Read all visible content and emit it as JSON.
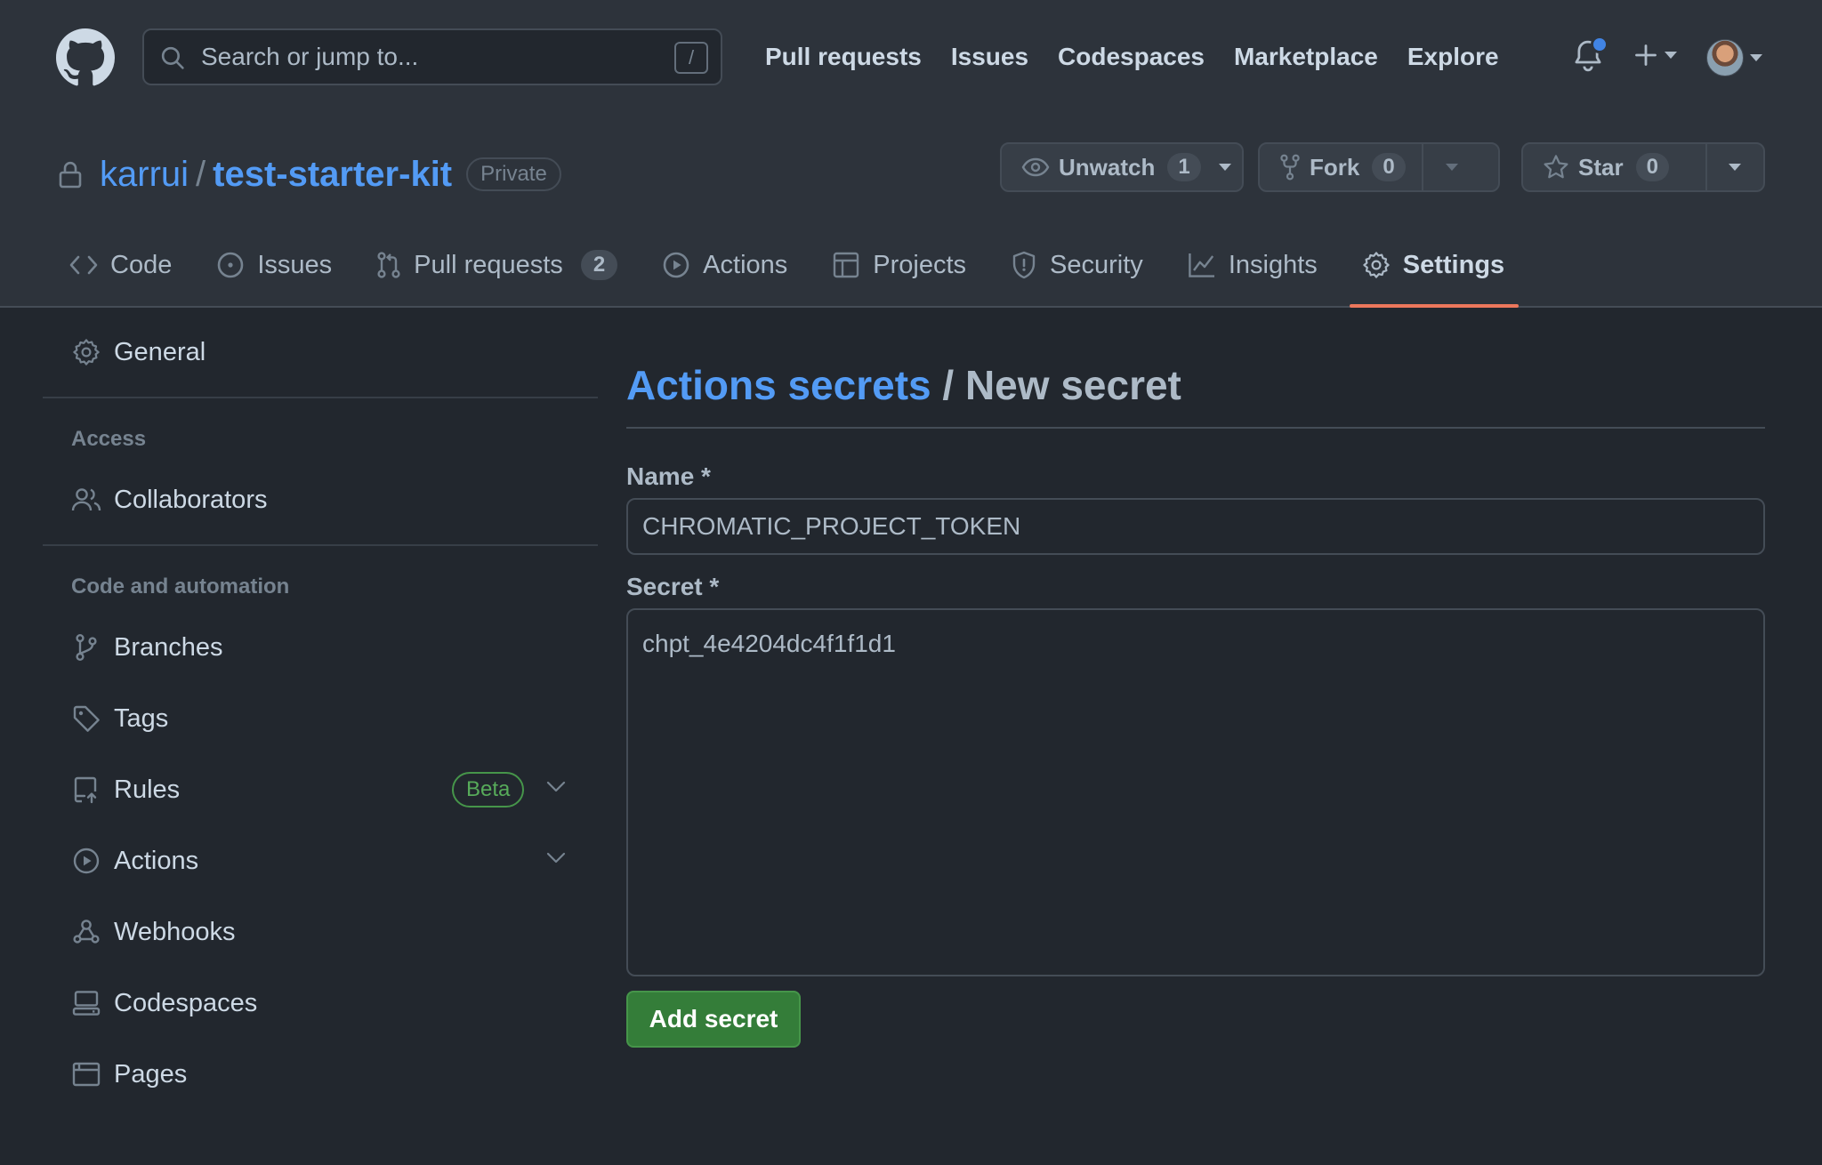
{
  "header": {
    "search_placeholder": "Search or jump to...",
    "search_shortcut": "/",
    "nav": [
      "Pull requests",
      "Issues",
      "Codespaces",
      "Marketplace",
      "Explore"
    ]
  },
  "repo": {
    "owner": "karrui",
    "separator": "/",
    "name": "test-starter-kit",
    "visibility": "Private",
    "unwatch_label": "Unwatch",
    "unwatch_count": "1",
    "fork_label": "Fork",
    "fork_count": "0",
    "star_label": "Star",
    "star_count": "0"
  },
  "tabs": [
    {
      "label": "Code",
      "icon": "code-icon"
    },
    {
      "label": "Issues",
      "icon": "issue-icon"
    },
    {
      "label": "Pull requests",
      "icon": "pull-request-icon",
      "counter": "2"
    },
    {
      "label": "Actions",
      "icon": "play-icon"
    },
    {
      "label": "Projects",
      "icon": "table-icon"
    },
    {
      "label": "Security",
      "icon": "shield-icon"
    },
    {
      "label": "Insights",
      "icon": "graph-icon"
    },
    {
      "label": "Settings",
      "icon": "gear-icon",
      "active": true
    }
  ],
  "sidebar": {
    "general": "General",
    "access_heading": "Access",
    "collaborators": "Collaborators",
    "code_heading": "Code and automation",
    "branches": "Branches",
    "tags": "Tags",
    "rules": "Rules",
    "rules_badge": "Beta",
    "actions": "Actions",
    "webhooks": "Webhooks",
    "codespaces": "Codespaces",
    "pages": "Pages"
  },
  "main": {
    "crumb_link": "Actions secrets",
    "crumb_separator": "/",
    "crumb_current": "New secret",
    "name_label": "Name *",
    "name_value": "CHROMATIC_PROJECT_TOKEN",
    "secret_label": "Secret *",
    "secret_value": "chpt_4e4204dc4f1f1d1",
    "submit_label": "Add secret"
  },
  "colors": {
    "accent_link": "#539bf5",
    "active_tab_underline": "#ec775c",
    "primary_button": "#347d39",
    "notification_dot": "#4184e4"
  }
}
